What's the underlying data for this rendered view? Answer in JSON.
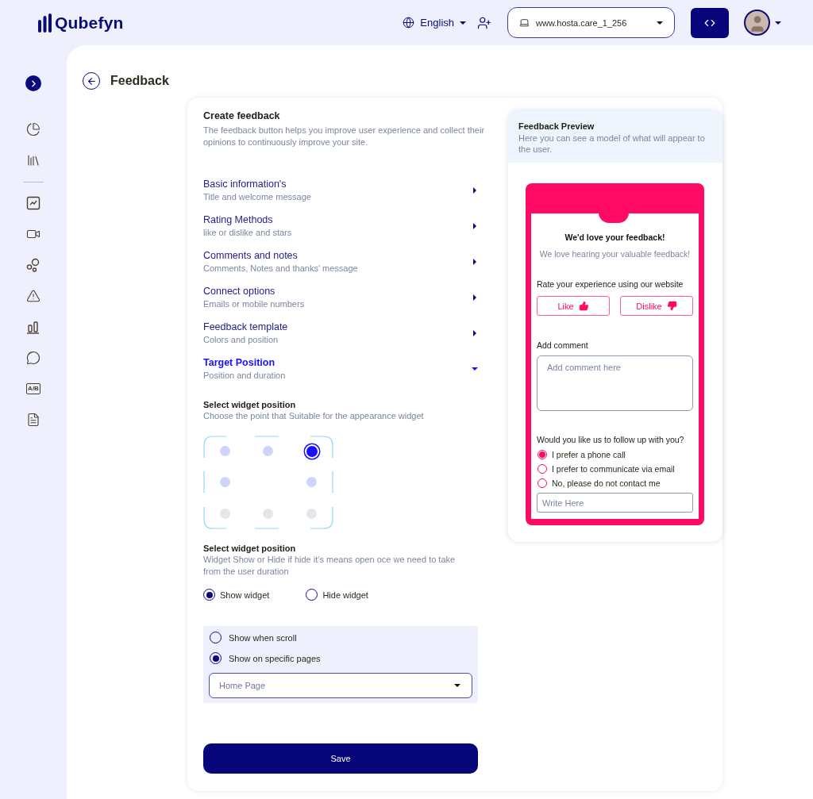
{
  "topbar": {
    "logo": "Qubefyn",
    "language": "English",
    "site": "www.hosta.care_1_256"
  },
  "sidebar": {
    "ab_label": "A/B"
  },
  "page": {
    "title": "Feedback"
  },
  "form": {
    "title": "Create feedback",
    "description": "The feedback button helps you improve user experience and collect their opinions to continuously improve your site.",
    "sections": [
      {
        "title": "Basic information's",
        "subtitle": "Title and welcome message",
        "expanded": false
      },
      {
        "title": "Rating Methods",
        "subtitle": "like or dislike and stars",
        "expanded": false
      },
      {
        "title": "Comments and notes",
        "subtitle": "Comments, Notes and thanks' message",
        "expanded": false
      },
      {
        "title": "Connect options",
        "subtitle": "Emails or mobile numbers",
        "expanded": false
      },
      {
        "title": "Feedback template",
        "subtitle": "Colors and position",
        "expanded": false
      },
      {
        "title": "Target Position",
        "subtitle": "Position and duration",
        "expanded": true
      }
    ]
  },
  "position": {
    "title": "Select widget position",
    "description": "Choose the point that Suitable for the appearance widget",
    "slots": [
      {
        "kind": "dot",
        "selected": false,
        "disabled": false
      },
      {
        "kind": "dot",
        "selected": false,
        "disabled": false
      },
      {
        "kind": "dot",
        "selected": true,
        "disabled": false
      },
      {
        "kind": "dot",
        "selected": false,
        "disabled": false
      },
      {
        "kind": "none"
      },
      {
        "kind": "dot",
        "selected": false,
        "disabled": false
      },
      {
        "kind": "dot",
        "selected": false,
        "disabled": true
      },
      {
        "kind": "dot",
        "selected": false,
        "disabled": true
      },
      {
        "kind": "dot",
        "selected": false,
        "disabled": true
      }
    ]
  },
  "visibility": {
    "title": "Select widget position",
    "description": "Widget Show or Hide if hide it’s means open oce we need to take from the user duration",
    "options": [
      {
        "label": "Show widget",
        "selected": true
      },
      {
        "label": "Hide widget",
        "selected": false
      }
    ],
    "modes": [
      {
        "label": "Show when scroll",
        "selected": false
      },
      {
        "label": "Show on specific pages",
        "selected": true
      }
    ],
    "page_select": "Home Page"
  },
  "save": "Save",
  "preview": {
    "title": "Feedback Preview",
    "description": "Here you can see a model of what will appear to the user.",
    "widget": {
      "heading": "We'd love your feedback!",
      "subheading": "We love hearing your valuable feedback!",
      "rate_label": "Rate your experience using our website",
      "like": "Like",
      "dislike": "Dislike",
      "comment_label": "Add comment",
      "comment_placeholder": "Add comment here",
      "followup_label": "Would you like us to follow up with you?",
      "followup_options": [
        {
          "label": "I prefer a phone call",
          "selected": true
        },
        {
          "label": "I prefer to communicate via email",
          "selected": false
        },
        {
          "label": "No, please do not contact me",
          "selected": false
        }
      ],
      "write_placeholder": "Write Here"
    }
  }
}
